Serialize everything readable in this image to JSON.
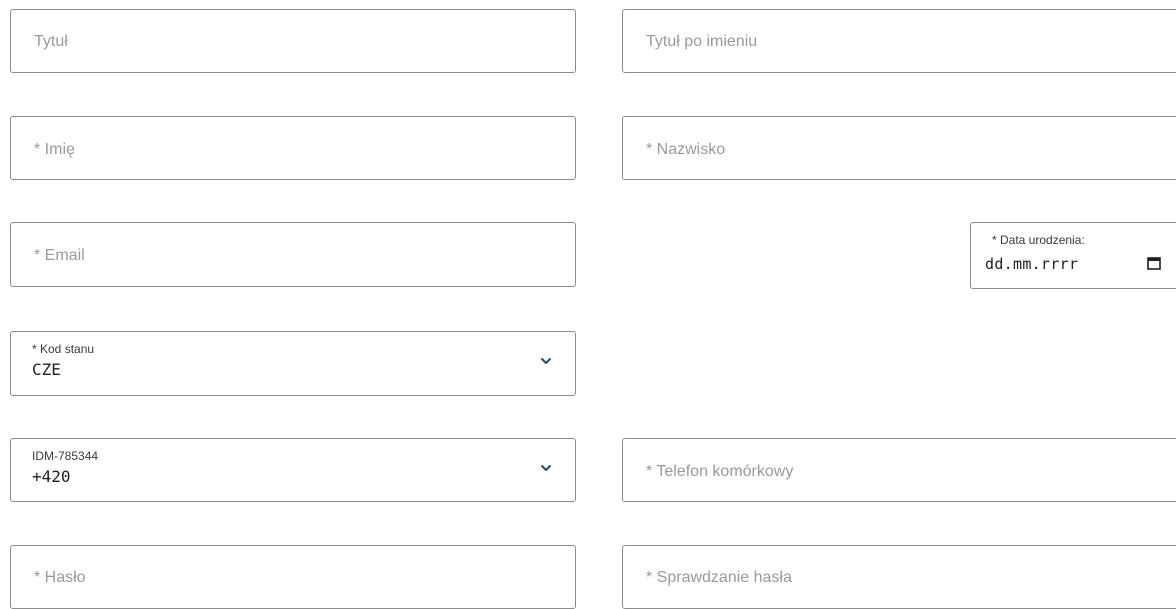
{
  "form": {
    "title_placeholder": "Tytuł",
    "title_after_placeholder": "Tytuł po imieniu",
    "first_name_placeholder": "* Imię",
    "last_name_placeholder": "* Nazwisko",
    "email_placeholder": "* Email",
    "birth_date": {
      "label": "* Data urodzenia:",
      "value": "dd.mm.rrrr",
      "icon": "calendar-icon"
    },
    "state_code": {
      "label": "* Kod stanu",
      "value": "CZE",
      "icon": "chevron-down-icon"
    },
    "phone_prefix": {
      "label": "IDM-785344",
      "value": "+420",
      "icon": "chevron-down-icon"
    },
    "mobile_placeholder": "* Telefon komórkowy",
    "password_placeholder": "* Hasło",
    "password_check_placeholder": "* Sprawdzanie hasła"
  },
  "colors": {
    "border": "#8c8c8c",
    "placeholder": "#9a9a9a",
    "chevron": "#1f4e79"
  }
}
